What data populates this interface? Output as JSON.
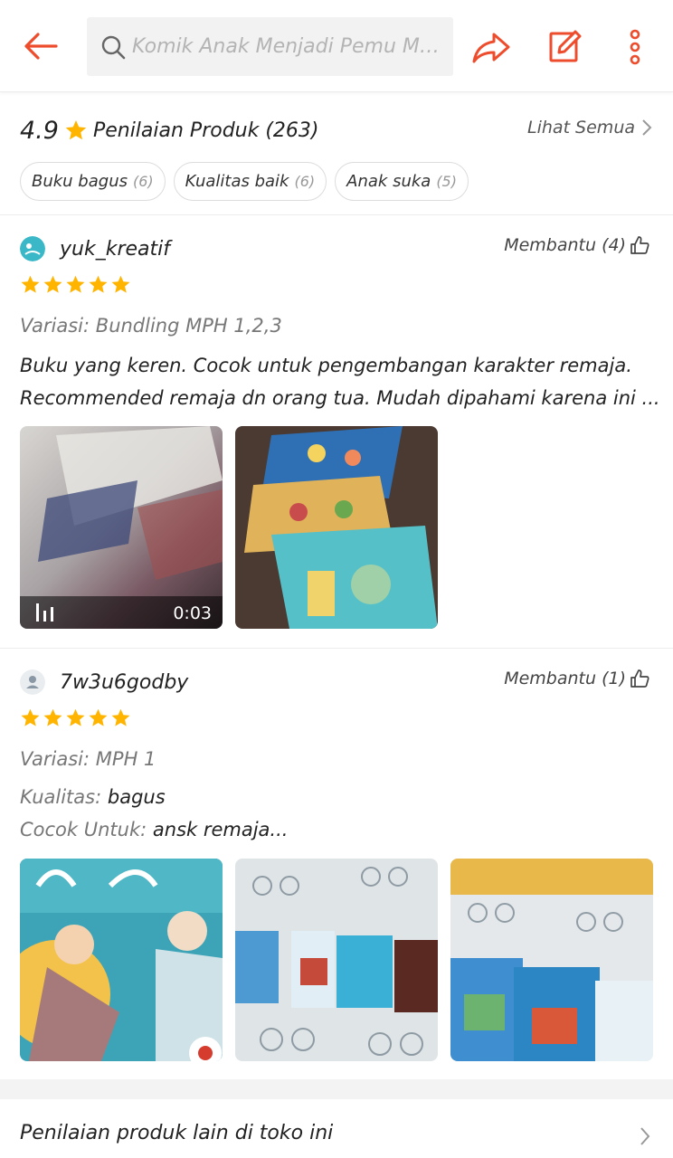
{
  "header": {
    "search_text": "Komik Anak Menjadi Pemu Me...",
    "icons": [
      "back-arrow-icon",
      "search-icon",
      "share-icon",
      "edit-icon",
      "more-vertical-icon"
    ],
    "accent_color": "#ee4d2d"
  },
  "rating": {
    "score": "4.9",
    "title": "Penilaian Produk (263)",
    "see_all": "Lihat Semua",
    "star_color": "#ffb400"
  },
  "chips": [
    {
      "label": "Buku bagus",
      "count": "(6)"
    },
    {
      "label": "Kualitas baik",
      "count": "(6)"
    },
    {
      "label": "Anak suka",
      "count": "(5)"
    }
  ],
  "reviews": [
    {
      "username": "yuk_kreatif",
      "helpful": "Membantu (4)",
      "stars": 5,
      "variation_label": "Variasi:",
      "variation_value": "Bundling MPH 1,2,3",
      "body_line1": "Buku yang keren. Cocok untuk pengembangan karakter remaja.",
      "body_line2": "Recommended remaja dn orang tua. Mudah dipahami karena ini ...",
      "video_duration": "0:03"
    },
    {
      "username": "7w3u6godby",
      "helpful": "Membantu (1)",
      "stars": 5,
      "variation_label": "Variasi:",
      "variation_value": "MPH 1",
      "quality_label": "Kualitas:",
      "quality_value": "bagus",
      "fit_label": "Cocok Untuk:",
      "fit_value": "ansk remaja..."
    }
  ],
  "footer": {
    "label": "Penilaian produk lain di toko ini"
  }
}
